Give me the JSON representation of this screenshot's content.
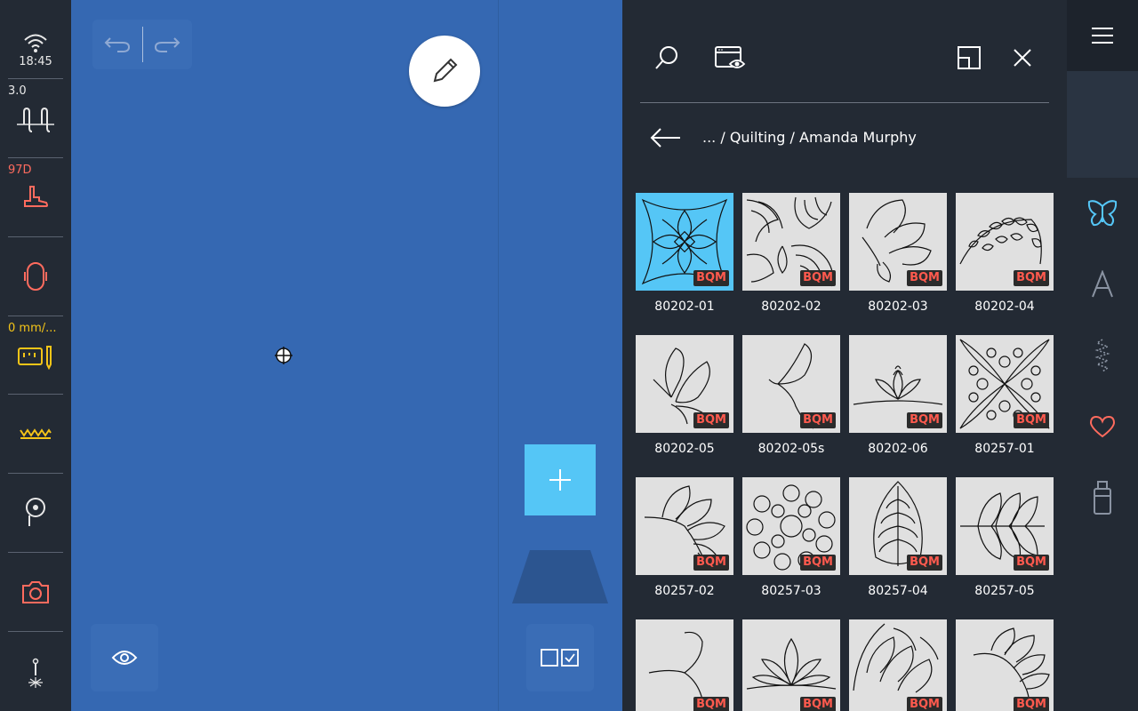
{
  "status": {
    "time": "18:45",
    "stitch_length": "3.0",
    "presser_foot": "97D",
    "speed": "0 mm/..."
  },
  "panel": {
    "breadcrumb": "... / Quilting / Amanda Murphy",
    "badge": "BQM",
    "designs": [
      {
        "label": "80202-01",
        "selected": true
      },
      {
        "label": "80202-02",
        "selected": false
      },
      {
        "label": "80202-03",
        "selected": false
      },
      {
        "label": "80202-04",
        "selected": false
      },
      {
        "label": "80202-05",
        "selected": false
      },
      {
        "label": "80202-05s",
        "selected": false
      },
      {
        "label": "80202-06",
        "selected": false
      },
      {
        "label": "80257-01",
        "selected": false
      },
      {
        "label": "80257-02",
        "selected": false
      },
      {
        "label": "80257-03",
        "selected": false
      },
      {
        "label": "80257-04",
        "selected": false
      },
      {
        "label": "80257-05",
        "selected": false
      },
      {
        "label": "",
        "selected": false
      },
      {
        "label": "",
        "selected": false
      },
      {
        "label": "",
        "selected": false
      },
      {
        "label": "",
        "selected": false
      }
    ]
  },
  "icons": {
    "wifi": "wifi-icon",
    "stitch": "stitch-width-icon",
    "foot": "presser-foot-icon",
    "hoop": "hoop-icon",
    "speed": "speed-icon",
    "zigzag": "zigzag-icon",
    "bobbin": "bobbin-icon",
    "camera": "camera-icon",
    "needle": "needle-icon"
  },
  "colors": {
    "accent": "#55c6f6",
    "canvas": "#3568b2",
    "panel": "#232a34",
    "alert": "#ff5a4e",
    "warning": "#f5c518"
  }
}
